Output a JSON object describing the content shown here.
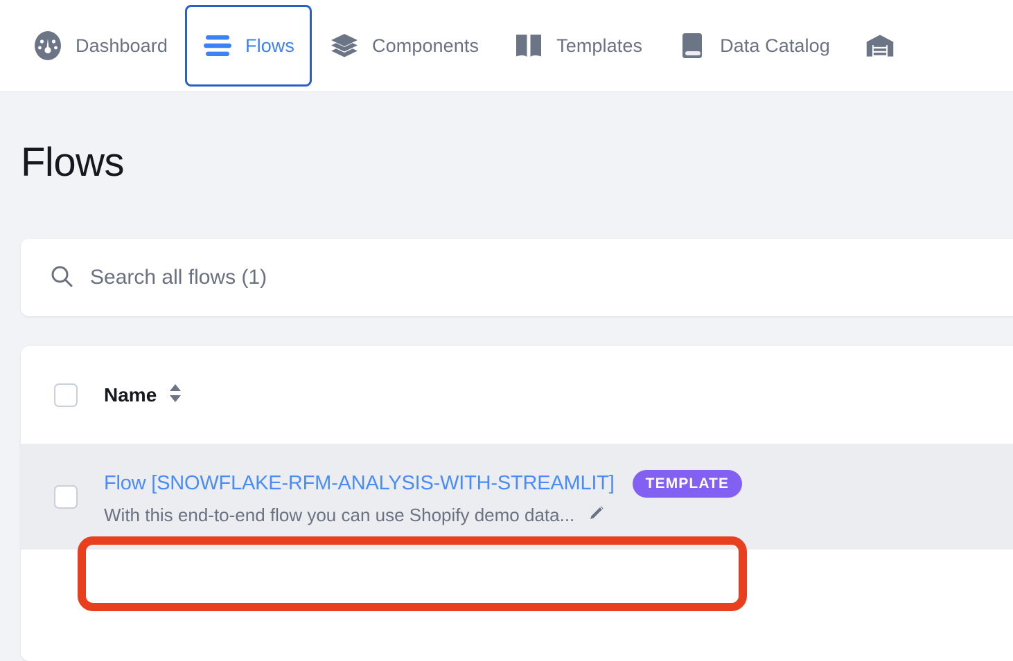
{
  "navbar": {
    "items": [
      {
        "label": "Dashboard",
        "icon": "gauge-icon",
        "active": false
      },
      {
        "label": "Flows",
        "icon": "flows-lines-icon",
        "active": true
      },
      {
        "label": "Components",
        "icon": "layers-stack-icon",
        "active": false
      },
      {
        "label": "Templates",
        "icon": "open-book-icon",
        "active": false
      },
      {
        "label": "Data Catalog",
        "icon": "closed-book-icon",
        "active": false
      },
      {
        "label": "",
        "icon": "warehouse-icon",
        "active": false
      }
    ]
  },
  "page": {
    "title": "Flows"
  },
  "search": {
    "placeholder": "Search all flows (1)",
    "value": "",
    "icon": "search-icon"
  },
  "table": {
    "header": {
      "select_all_checkbox": "unchecked",
      "columns": [
        {
          "label": "Name",
          "sortable": true,
          "sort_icon": "sort-updown-icon"
        }
      ]
    },
    "rows": [
      {
        "checkbox": "unchecked",
        "title": "Flow [SNOWFLAKE-RFM-ANALYSIS-WITH-STREAMLIT]",
        "badge": "TEMPLATE",
        "description": "With this end-to-end flow you can use Shopify demo data...",
        "edit_icon": "pencil-icon"
      }
    ]
  },
  "annotation": {
    "type": "highlight-rectangle",
    "color": "#e8401f",
    "target": "flow-title-link"
  },
  "colors": {
    "accent_blue": "#3b82f6",
    "link_blue": "#4a8cf7",
    "active_tab_border": "#2a5fcb",
    "badge_purple": "#8160f2",
    "annotation_red": "#e8401f",
    "page_background": "#f1f3f7",
    "row_background": "#ebedf1",
    "icon_gray": "#6c7585",
    "text_muted": "#6a7282",
    "text_dark": "#15181e"
  }
}
